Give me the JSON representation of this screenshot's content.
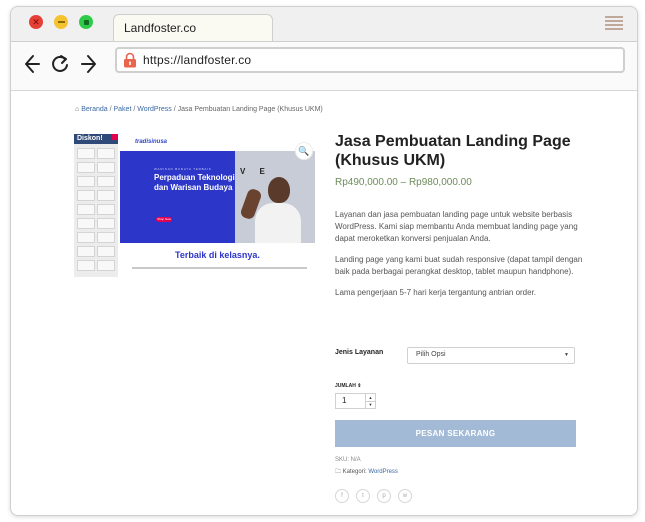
{
  "browser": {
    "tab_title": "Landfoster.co",
    "url": "https://landfoster.co"
  },
  "breadcrumb": {
    "home": "Beranda",
    "sep": " / ",
    "paket": "Paket",
    "wordpress": "WordPress",
    "current": "Jasa Pembuatan Landing Page (Khusus UKM)"
  },
  "gallery": {
    "panel_label": "Diskon!",
    "brand": "tradisinusa",
    "kicker": "WARISAN BUDAYA TERBAIK",
    "hero_title": "Perpaduan Teknologi dan Warisan Budaya",
    "hero_button": "Shop Now",
    "hero_letters": "V E",
    "subtitle": "Terbaik di kelasnya."
  },
  "product": {
    "title": "Jasa Pembuatan Landing Page (Khusus UKM)",
    "price": "Rp490,000.00 – Rp980,000.00",
    "description": [
      "Layanan dan jasa pembuatan landing page untuk website berbasis WordPress. Kami siap membantu Anda membuat landing page yang dapat meroketkan konversi penjualan Anda.",
      "Landing page yang kami buat sudah responsive (dapat tampil dengan baik pada berbagai perangkat desktop, tablet maupun handphone).",
      "Lama pengerjaan 5-7 hari kerja tergantung antrian order."
    ],
    "layanan_label": "Jenis Layanan",
    "layanan_placeholder": "Pilih Opsi",
    "qty_label": "JUMLAH",
    "qty_value": "1",
    "buy_button": "PESAN SEKARANG",
    "sku": "SKU: N/A",
    "category_label": "Kategori:",
    "category_value": "WordPress"
  },
  "social_icons": [
    "facebook-icon",
    "twitter-icon",
    "pinterest-icon",
    "whatsapp-icon"
  ],
  "colors": {
    "button": "#a2bad5",
    "price": "#6c8c5a",
    "link": "#3c6aa5",
    "hero": "#2c36c9"
  }
}
